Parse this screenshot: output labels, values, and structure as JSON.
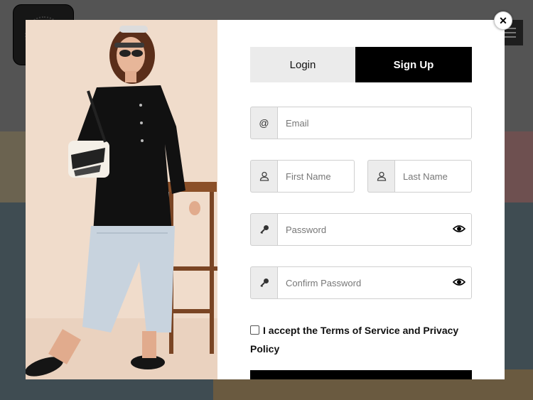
{
  "modal": {
    "tabs": [
      {
        "label": "Login",
        "active": false
      },
      {
        "label": "Sign Up",
        "active": true
      }
    ],
    "close_icon": "close-icon",
    "fields": {
      "email": {
        "addon": "@",
        "placeholder": "Email"
      },
      "first_name": {
        "placeholder": "First Name",
        "icon": "user-icon"
      },
      "last_name": {
        "placeholder": "Last Name",
        "icon": "user-icon"
      },
      "password": {
        "placeholder": "Password",
        "icon": "key-icon",
        "toggle_icon": "eye-icon"
      },
      "confirm_password": {
        "placeholder": "Confirm Password",
        "icon": "key-icon",
        "toggle_icon": "eye-icon"
      }
    },
    "terms": {
      "label": "I accept the Terms of Service and Privacy Policy",
      "checked": false
    }
  },
  "colors": {
    "accent": "#000000",
    "tab_inactive": "#ebebeb",
    "addon_bg": "#ececec",
    "photo_bg": "#f0dccb"
  }
}
